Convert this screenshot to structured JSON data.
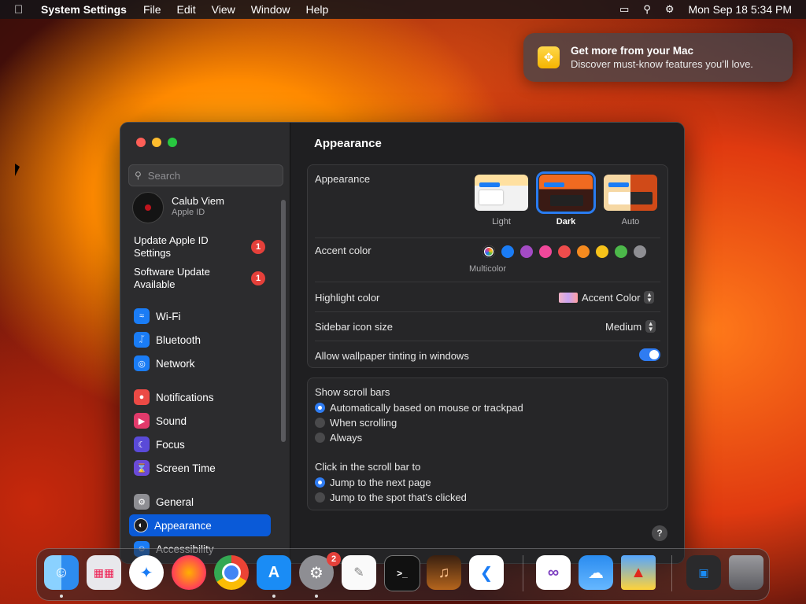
{
  "menubar": {
    "app_name": "System Settings",
    "menus": [
      "File",
      "Edit",
      "View",
      "Window",
      "Help"
    ],
    "datetime": "Mon Sep 18  5:34 PM"
  },
  "notification": {
    "title": "Get more from your Mac",
    "body": "Discover must-know features you’ll love."
  },
  "sidebar": {
    "search_placeholder": "Search",
    "profile": {
      "name": "Calub Viem",
      "subtitle": "Apple ID"
    },
    "alerts": [
      {
        "label": "Update Apple ID Settings",
        "badge": "1"
      },
      {
        "label": "Software Update Available",
        "badge": "1"
      }
    ],
    "items": [
      {
        "label": "Wi-Fi",
        "icon": "wifi-icon",
        "color": "#1a7cf5"
      },
      {
        "label": "Bluetooth",
        "icon": "bluetooth-icon",
        "color": "#1a7cf5"
      },
      {
        "label": "Network",
        "icon": "globe-icon",
        "color": "#1a7cf5"
      },
      {
        "label": "Notifications",
        "icon": "bell-icon",
        "color": "#ec4a45"
      },
      {
        "label": "Sound",
        "icon": "speaker-icon",
        "color": "#e23a6b"
      },
      {
        "label": "Focus",
        "icon": "moon-icon",
        "color": "#5a4ad8"
      },
      {
        "label": "Screen Time",
        "icon": "hourglass-icon",
        "color": "#6a4ad8"
      },
      {
        "label": "General",
        "icon": "gear-icon",
        "color": "#8e8e93"
      },
      {
        "label": "Appearance",
        "icon": "appearance-icon",
        "color": "#1c1c1e",
        "active": true
      },
      {
        "label": "Accessibility",
        "icon": "accessibility-icon",
        "color": "#1a7cf5"
      }
    ]
  },
  "main": {
    "title": "Appearance",
    "appearance": {
      "label": "Appearance",
      "options": [
        "Light",
        "Dark",
        "Auto"
      ],
      "selected": "Dark"
    },
    "accent": {
      "label": "Accent color",
      "colors": [
        "multicolor",
        "#1a7cf5",
        "#a34bc4",
        "#f0489a",
        "#ee4c4c",
        "#f58a1f",
        "#f6c21a",
        "#4cb84a",
        "#8e8e93"
      ],
      "selected_label": "Multicolor"
    },
    "highlight": {
      "label": "Highlight color",
      "value": "Accent Color"
    },
    "sidebar_icon_size": {
      "label": "Sidebar icon size",
      "value": "Medium"
    },
    "wallpaper_tinting": {
      "label": "Allow wallpaper tinting in windows",
      "enabled": true
    },
    "scroll_bars": {
      "label": "Show scroll bars",
      "options": [
        "Automatically based on mouse or trackpad",
        "When scrolling",
        "Always"
      ],
      "selected": 0
    },
    "click_scroll": {
      "label": "Click in the scroll bar to",
      "options": [
        "Jump to the next page",
        "Jump to the spot that’s clicked"
      ],
      "selected": 0
    },
    "help": "?"
  },
  "dock": {
    "system_settings_badge": "2",
    "apps": [
      "Finder",
      "Launchpad",
      "Safari",
      "Firefox",
      "Chrome",
      "App Store",
      "System Settings",
      "TextEdit",
      "Terminal",
      "GarageBand",
      "VS Code",
      "Visual Studio",
      "Weather",
      "Game",
      "Recent",
      "Trash"
    ]
  }
}
